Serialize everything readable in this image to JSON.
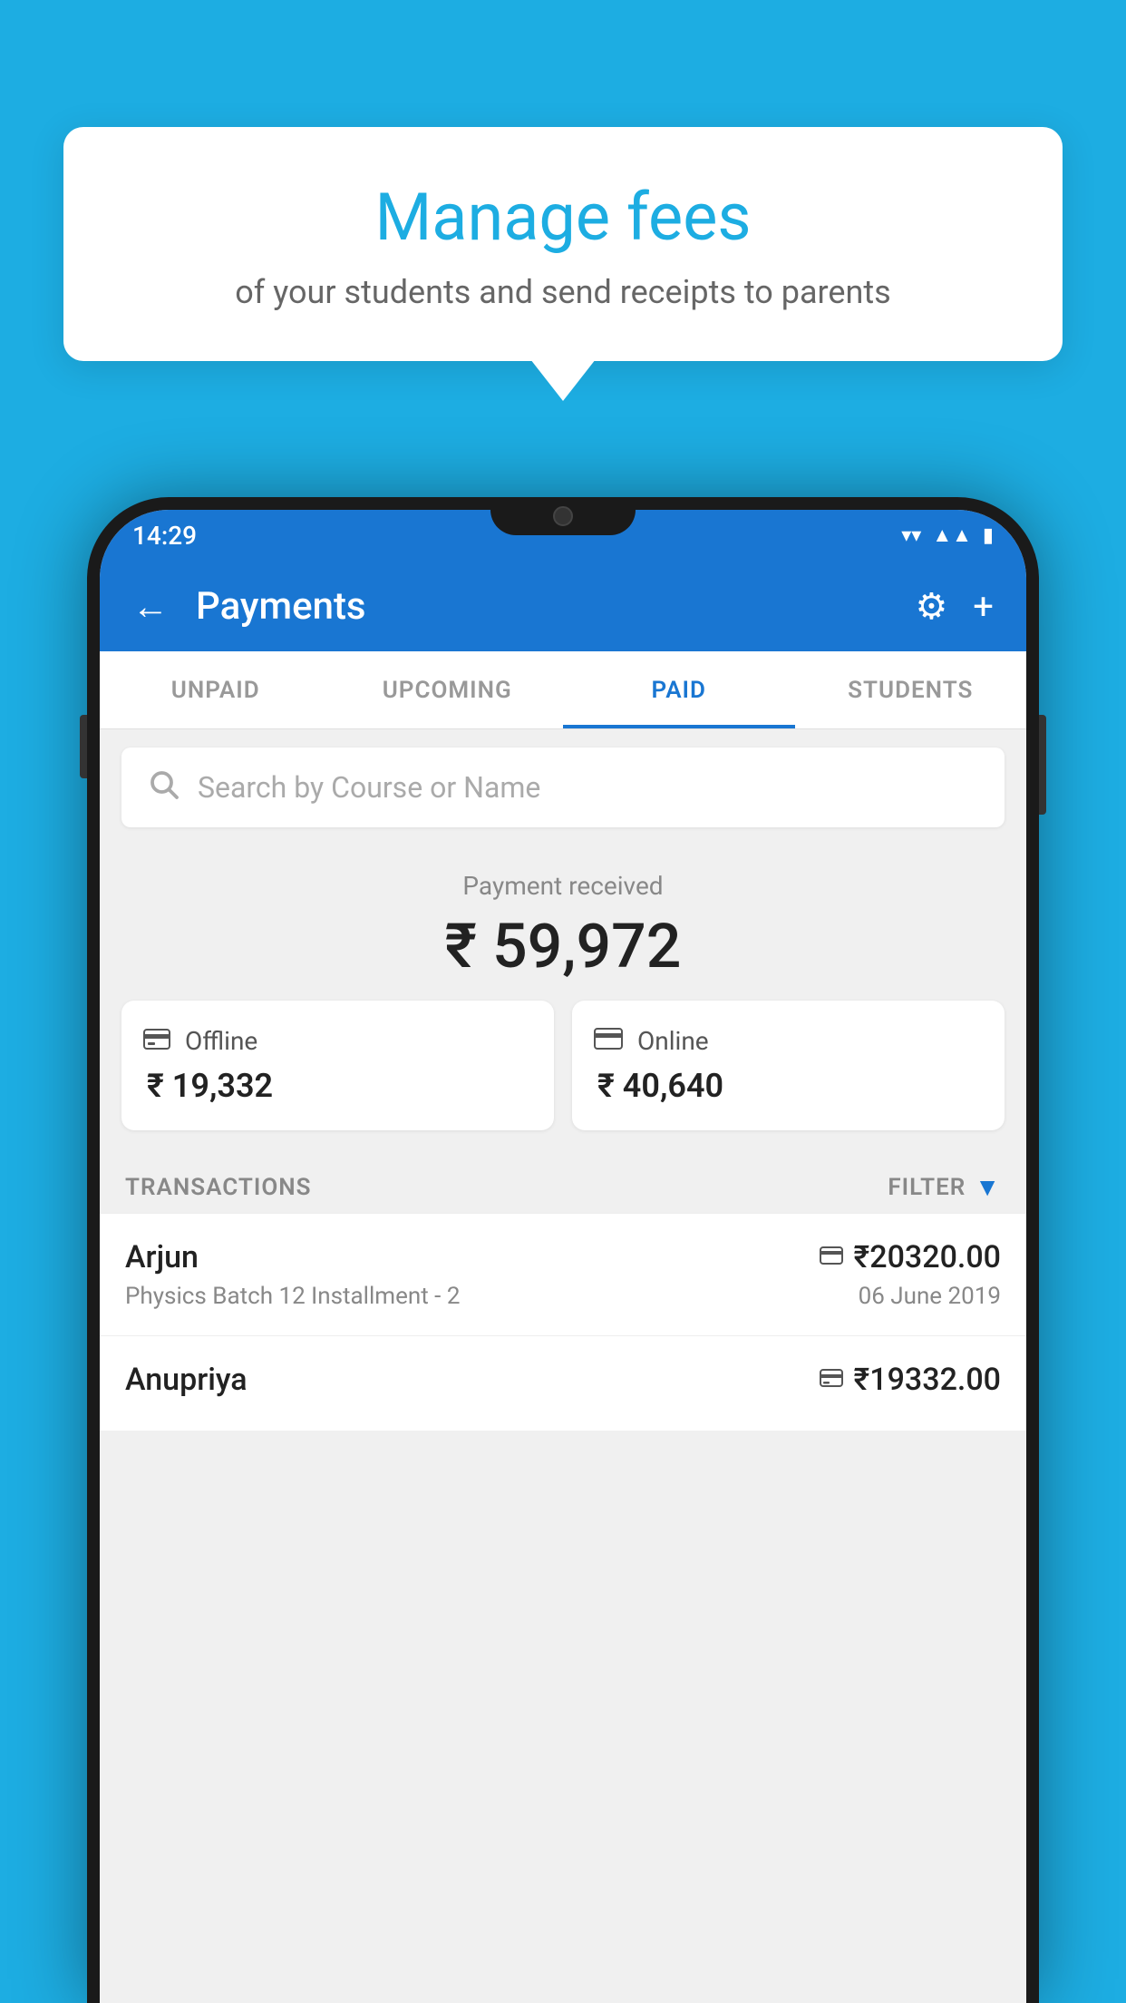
{
  "background_color": "#1DADE2",
  "tooltip": {
    "title": "Manage fees",
    "subtitle": "of your students and send receipts to parents"
  },
  "status_bar": {
    "time": "14:29",
    "wifi": "▼",
    "signal": "▲",
    "battery": "▮"
  },
  "app_bar": {
    "title": "Payments",
    "back_label": "←",
    "gear_label": "⚙",
    "plus_label": "+"
  },
  "tabs": [
    {
      "label": "UNPAID",
      "active": false
    },
    {
      "label": "UPCOMING",
      "active": false
    },
    {
      "label": "PAID",
      "active": true
    },
    {
      "label": "STUDENTS",
      "active": false
    }
  ],
  "search": {
    "placeholder": "Search by Course or Name"
  },
  "payment_received": {
    "label": "Payment received",
    "amount": "₹ 59,972"
  },
  "payment_cards": [
    {
      "type": "Offline",
      "amount": "₹ 19,332",
      "icon": "offline"
    },
    {
      "type": "Online",
      "amount": "₹ 40,640",
      "icon": "online"
    }
  ],
  "transactions_label": "TRANSACTIONS",
  "filter_label": "FILTER",
  "transactions": [
    {
      "name": "Arjun",
      "description": "Physics Batch 12 Installment - 2",
      "amount": "₹20320.00",
      "date": "06 June 2019",
      "payment_type": "online"
    },
    {
      "name": "Anupriya",
      "description": "",
      "amount": "₹19332.00",
      "date": "",
      "payment_type": "offline"
    }
  ]
}
